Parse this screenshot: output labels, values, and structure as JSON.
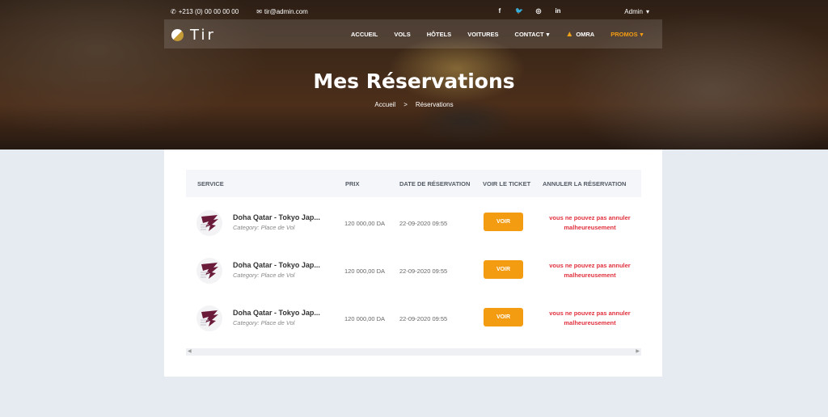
{
  "topbar": {
    "phone": "+213 (0) 00 00 00 00",
    "email": "tir@admin.com",
    "social": [
      "f",
      "t",
      "ig",
      "in"
    ],
    "admin": "Admin"
  },
  "nav": {
    "logo": "Tir",
    "items": [
      "ACCUEIL",
      "VOLS",
      "HÔTELS",
      "VOITURES",
      "CONTACT",
      "OMRA",
      "PROMOS"
    ]
  },
  "hero": {
    "title": "Mes Réservations",
    "breadcrumb": [
      "Accueil",
      ">",
      "Réservations"
    ]
  },
  "table": {
    "headers": [
      "SERVICE",
      "PRIX",
      "DATE DE RÉSERVATION",
      "VOIR LE TICKET",
      "ANNULER LA RÉSERVATION"
    ],
    "rows": [
      {
        "service": "Doha Qatar - Tokyo Jap...",
        "category": "Category: Place de Vol",
        "price": "120 000,00 DA",
        "date": "22-09-2020 09:55",
        "button": "VOIR",
        "cancel": "vous ne pouvez pas annuler malheureusement"
      },
      {
        "service": "Doha Qatar - Tokyo Jap...",
        "category": "Category: Place de Vol",
        "price": "120 000,00 DA",
        "date": "22-09-2020 09:55",
        "button": "VOIR",
        "cancel": "vous ne pouvez pas annuler malheureusement"
      },
      {
        "service": "Doha Qatar - Tokyo Jap...",
        "category": "Category: Place de Vol",
        "price": "120 000,00 DA",
        "date": "22-09-2020 09:55",
        "button": "VOIR",
        "cancel": "vous ne pouvez pas annuler malheureusement"
      }
    ]
  },
  "colors": {
    "accent": "#f39c12",
    "danger": "#e0303d",
    "airline": "#6a1b3a"
  }
}
